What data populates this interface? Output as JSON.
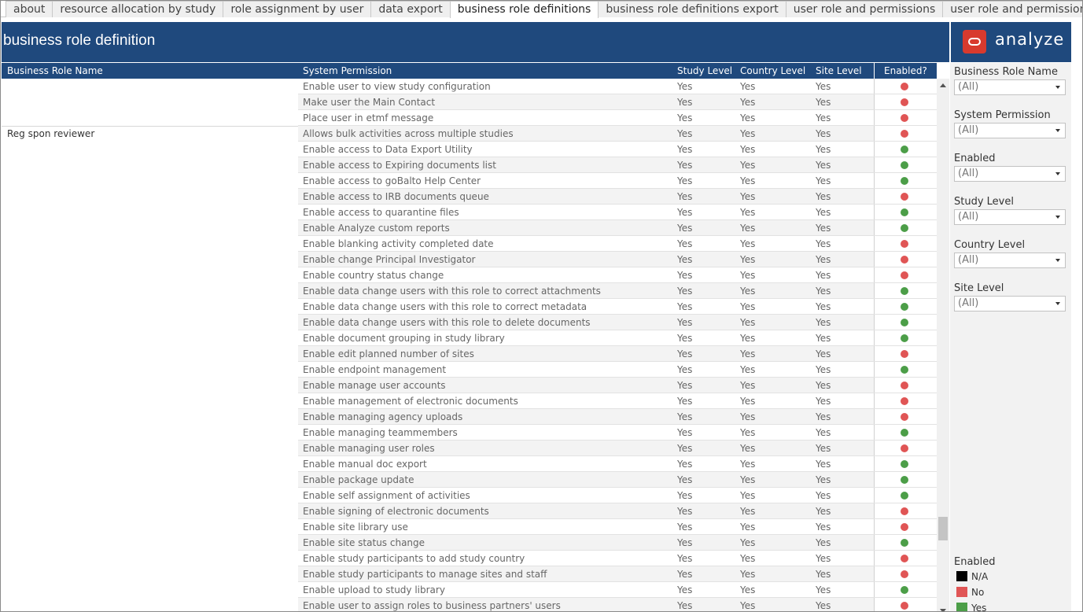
{
  "tabs": [
    {
      "label": "about",
      "active": false
    },
    {
      "label": "resource allocation by study",
      "active": false
    },
    {
      "label": "role assignment by user",
      "active": false
    },
    {
      "label": "data export",
      "active": false
    },
    {
      "label": "business role definitions",
      "active": true
    },
    {
      "label": "business role definitions export",
      "active": false
    },
    {
      "label": "user role and permissions",
      "active": false
    },
    {
      "label": "user role and permissions exp...",
      "active": false
    }
  ],
  "page_title": "business role definition",
  "logo_text": "analyze",
  "columns": {
    "role": "Business Role Name",
    "permission": "System Permission",
    "study": "Study Level",
    "country": "Country Level",
    "site": "Site Level",
    "enabled": "Enabled?"
  },
  "colors": {
    "header_bg": "#1f497d",
    "yes": "#4c9e48",
    "no": "#e05555",
    "na": "#000000"
  },
  "groups": [
    {
      "role": "",
      "start": 0
    },
    {
      "role": "Reg spon reviewer",
      "start": 3
    }
  ],
  "rows": [
    {
      "permission": "Enable user to view study configuration",
      "study": "Yes",
      "country": "Yes",
      "site": "Yes",
      "enabled": "No"
    },
    {
      "permission": "Make user the Main Contact",
      "study": "Yes",
      "country": "Yes",
      "site": "Yes",
      "enabled": "No"
    },
    {
      "permission": "Place user in etmf message",
      "study": "Yes",
      "country": "Yes",
      "site": "Yes",
      "enabled": "No"
    },
    {
      "permission": "Allows bulk activities across multiple studies",
      "study": "Yes",
      "country": "Yes",
      "site": "Yes",
      "enabled": "No"
    },
    {
      "permission": "Enable access to Data Export Utility",
      "study": "Yes",
      "country": "Yes",
      "site": "Yes",
      "enabled": "Yes"
    },
    {
      "permission": "Enable access to Expiring documents list",
      "study": "Yes",
      "country": "Yes",
      "site": "Yes",
      "enabled": "Yes"
    },
    {
      "permission": "Enable access to goBalto Help Center",
      "study": "Yes",
      "country": "Yes",
      "site": "Yes",
      "enabled": "Yes"
    },
    {
      "permission": "Enable access to IRB documents queue",
      "study": "Yes",
      "country": "Yes",
      "site": "Yes",
      "enabled": "No"
    },
    {
      "permission": "Enable access to quarantine files",
      "study": "Yes",
      "country": "Yes",
      "site": "Yes",
      "enabled": "Yes"
    },
    {
      "permission": "Enable Analyze custom reports",
      "study": "Yes",
      "country": "Yes",
      "site": "Yes",
      "enabled": "Yes"
    },
    {
      "permission": "Enable blanking activity completed date",
      "study": "Yes",
      "country": "Yes",
      "site": "Yes",
      "enabled": "No"
    },
    {
      "permission": "Enable change Principal Investigator",
      "study": "Yes",
      "country": "Yes",
      "site": "Yes",
      "enabled": "No"
    },
    {
      "permission": "Enable country status change",
      "study": "Yes",
      "country": "Yes",
      "site": "Yes",
      "enabled": "No"
    },
    {
      "permission": "Enable data change users with this role to correct attachments",
      "study": "Yes",
      "country": "Yes",
      "site": "Yes",
      "enabled": "Yes"
    },
    {
      "permission": "Enable data change users with this role to correct metadata",
      "study": "Yes",
      "country": "Yes",
      "site": "Yes",
      "enabled": "Yes"
    },
    {
      "permission": "Enable data change users with this role to delete documents",
      "study": "Yes",
      "country": "Yes",
      "site": "Yes",
      "enabled": "Yes"
    },
    {
      "permission": "Enable document grouping in study library",
      "study": "Yes",
      "country": "Yes",
      "site": "Yes",
      "enabled": "Yes"
    },
    {
      "permission": "Enable edit planned number of sites",
      "study": "Yes",
      "country": "Yes",
      "site": "Yes",
      "enabled": "No"
    },
    {
      "permission": "Enable endpoint management",
      "study": "Yes",
      "country": "Yes",
      "site": "Yes",
      "enabled": "Yes"
    },
    {
      "permission": "Enable manage user accounts",
      "study": "Yes",
      "country": "Yes",
      "site": "Yes",
      "enabled": "No"
    },
    {
      "permission": "Enable management of electronic documents",
      "study": "Yes",
      "country": "Yes",
      "site": "Yes",
      "enabled": "No"
    },
    {
      "permission": "Enable managing agency uploads",
      "study": "Yes",
      "country": "Yes",
      "site": "Yes",
      "enabled": "No"
    },
    {
      "permission": "Enable managing teammembers",
      "study": "Yes",
      "country": "Yes",
      "site": "Yes",
      "enabled": "Yes"
    },
    {
      "permission": "Enable managing user roles",
      "study": "Yes",
      "country": "Yes",
      "site": "Yes",
      "enabled": "No"
    },
    {
      "permission": "Enable manual doc export",
      "study": "Yes",
      "country": "Yes",
      "site": "Yes",
      "enabled": "Yes"
    },
    {
      "permission": "Enable package update",
      "study": "Yes",
      "country": "Yes",
      "site": "Yes",
      "enabled": "Yes"
    },
    {
      "permission": "Enable self assignment of activities",
      "study": "Yes",
      "country": "Yes",
      "site": "Yes",
      "enabled": "Yes"
    },
    {
      "permission": "Enable signing of electronic documents",
      "study": "Yes",
      "country": "Yes",
      "site": "Yes",
      "enabled": "No"
    },
    {
      "permission": "Enable site library use",
      "study": "Yes",
      "country": "Yes",
      "site": "Yes",
      "enabled": "No"
    },
    {
      "permission": "Enable site status change",
      "study": "Yes",
      "country": "Yes",
      "site": "Yes",
      "enabled": "Yes"
    },
    {
      "permission": "Enable study participants to add study country",
      "study": "Yes",
      "country": "Yes",
      "site": "Yes",
      "enabled": "No"
    },
    {
      "permission": "Enable study participants to manage sites and staff",
      "study": "Yes",
      "country": "Yes",
      "site": "Yes",
      "enabled": "No"
    },
    {
      "permission": "Enable upload to study library",
      "study": "Yes",
      "country": "Yes",
      "site": "Yes",
      "enabled": "Yes"
    },
    {
      "permission": "Enable user to assign roles to business partners' users",
      "study": "Yes",
      "country": "Yes",
      "site": "Yes",
      "enabled": "No"
    }
  ],
  "filters": [
    {
      "label": "Business Role Name",
      "value": "(All)"
    },
    {
      "label": "System Permission",
      "value": "(All)"
    },
    {
      "label": "Enabled",
      "value": "(All)"
    },
    {
      "label": "Study Level",
      "value": "(All)"
    },
    {
      "label": "Country Level",
      "value": "(All)"
    },
    {
      "label": "Site Level",
      "value": "(All)"
    }
  ],
  "legend": {
    "title": "Enabled",
    "items": [
      {
        "label": "N/A",
        "color": "#000000"
      },
      {
        "label": "No",
        "color": "#e05555"
      },
      {
        "label": "Yes",
        "color": "#4c9e48"
      }
    ]
  }
}
